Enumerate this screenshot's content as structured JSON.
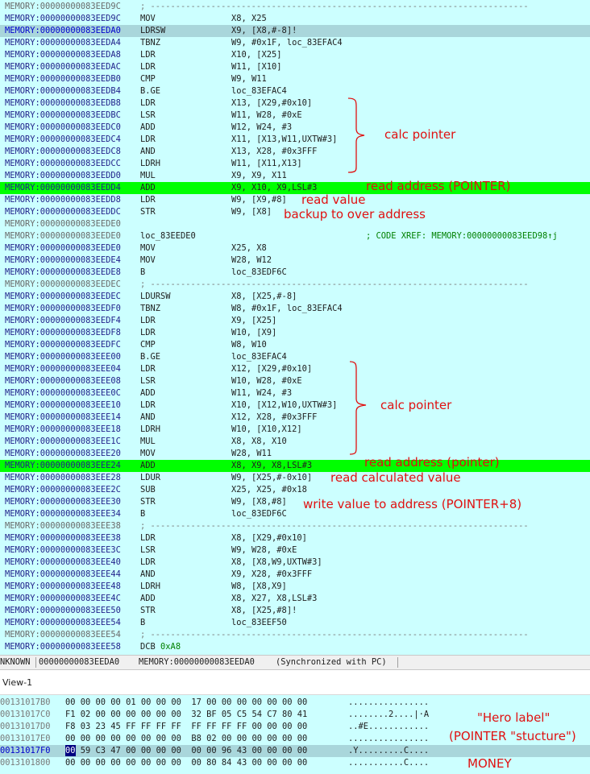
{
  "disasm": {
    "rows": [
      {
        "addr": "MEMORY:00000000083EED9C",
        "kind": "sep",
        "sep": "; ---------------------------------------------------------------------------"
      },
      {
        "addr": "MEMORY:00000000083EED9C",
        "mnem": "MOV",
        "ops": "X8, X25"
      },
      {
        "addr": "MEMORY:00000000083EEDA0",
        "mnem": "LDRSW",
        "ops": "X9, [X8,#-8]!",
        "hl": "blue"
      },
      {
        "addr": "MEMORY:00000000083EEDA4",
        "mnem": "TBNZ",
        "ops": "W9, #0x1F, loc_83EFAC4"
      },
      {
        "addr": "MEMORY:00000000083EEDA8",
        "mnem": "LDR",
        "ops": "X10, [X25]"
      },
      {
        "addr": "MEMORY:00000000083EEDAC",
        "mnem": "LDR",
        "ops": "W11, [X10]"
      },
      {
        "addr": "MEMORY:00000000083EEDB0",
        "mnem": "CMP",
        "ops": "W9, W11"
      },
      {
        "addr": "MEMORY:00000000083EEDB4",
        "mnem": "B.GE",
        "ops": "loc_83EFAC4"
      },
      {
        "addr": "MEMORY:00000000083EEDB8",
        "mnem": "LDR",
        "ops": "X13, [X29,#0x10]"
      },
      {
        "addr": "MEMORY:00000000083EEDBC",
        "mnem": "LSR",
        "ops": "W11, W28, #0xE"
      },
      {
        "addr": "MEMORY:00000000083EEDC0",
        "mnem": "ADD",
        "ops": "W12, W24, #3"
      },
      {
        "addr": "MEMORY:00000000083EEDC4",
        "mnem": "LDR",
        "ops": "X11, [X13,W11,UXTW#3]"
      },
      {
        "addr": "MEMORY:00000000083EEDC8",
        "mnem": "AND",
        "ops": "X13, X28, #0x3FFF"
      },
      {
        "addr": "MEMORY:00000000083EEDCC",
        "mnem": "LDRH",
        "ops": "W11, [X11,X13]"
      },
      {
        "addr": "MEMORY:00000000083EEDD0",
        "mnem": "MUL",
        "ops": "X9, X9, X11"
      },
      {
        "addr": "MEMORY:00000000083EEDD4",
        "mnem": "ADD",
        "ops": "X9, X10, X9,LSL#3",
        "hl": "green"
      },
      {
        "addr": "MEMORY:00000000083EEDD8",
        "mnem": "LDR",
        "ops": "W9, [X9,#8]"
      },
      {
        "addr": "MEMORY:00000000083EEDDC",
        "mnem": "STR",
        "ops": "W9, [X8]"
      },
      {
        "addr": "MEMORY:00000000083EEDE0",
        "kind": "empty"
      },
      {
        "addr": "MEMORY:00000000083EEDE0",
        "kind": "label",
        "label": "loc_83EEDE0",
        "xref": "; CODE XREF: MEMORY:00000000083EED98↑j"
      },
      {
        "addr": "MEMORY:00000000083EEDE0",
        "mnem": "MOV",
        "ops": "X25, X8"
      },
      {
        "addr": "MEMORY:00000000083EEDE4",
        "mnem": "MOV",
        "ops": "W28, W12"
      },
      {
        "addr": "MEMORY:00000000083EEDE8",
        "mnem": "B",
        "ops": "loc_83EDF6C"
      },
      {
        "addr": "MEMORY:00000000083EEDEC",
        "kind": "sep",
        "sep": "; ---------------------------------------------------------------------------"
      },
      {
        "addr": "MEMORY:00000000083EEDEC",
        "mnem": "LDURSW",
        "ops": "X8, [X25,#-8]"
      },
      {
        "addr": "MEMORY:00000000083EEDF0",
        "mnem": "TBNZ",
        "ops": "W8, #0x1F, loc_83EFAC4"
      },
      {
        "addr": "MEMORY:00000000083EEDF4",
        "mnem": "LDR",
        "ops": "X9, [X25]"
      },
      {
        "addr": "MEMORY:00000000083EEDF8",
        "mnem": "LDR",
        "ops": "W10, [X9]"
      },
      {
        "addr": "MEMORY:00000000083EEDFC",
        "mnem": "CMP",
        "ops": "W8, W10"
      },
      {
        "addr": "MEMORY:00000000083EEE00",
        "mnem": "B.GE",
        "ops": "loc_83EFAC4"
      },
      {
        "addr": "MEMORY:00000000083EEE04",
        "mnem": "LDR",
        "ops": "X12, [X29,#0x10]"
      },
      {
        "addr": "MEMORY:00000000083EEE08",
        "mnem": "LSR",
        "ops": "W10, W28, #0xE"
      },
      {
        "addr": "MEMORY:00000000083EEE0C",
        "mnem": "ADD",
        "ops": "W11, W24, #3"
      },
      {
        "addr": "MEMORY:00000000083EEE10",
        "mnem": "LDR",
        "ops": "X10, [X12,W10,UXTW#3]"
      },
      {
        "addr": "MEMORY:00000000083EEE14",
        "mnem": "AND",
        "ops": "X12, X28, #0x3FFF"
      },
      {
        "addr": "MEMORY:00000000083EEE18",
        "mnem": "LDRH",
        "ops": "W10, [X10,X12]"
      },
      {
        "addr": "MEMORY:00000000083EEE1C",
        "mnem": "MUL",
        "ops": "X8, X8, X10"
      },
      {
        "addr": "MEMORY:00000000083EEE20",
        "mnem": "MOV",
        "ops": "W28, W11"
      },
      {
        "addr": "MEMORY:00000000083EEE24",
        "mnem": "ADD",
        "ops": "X8, X9, X8,LSL#3",
        "hl": "green"
      },
      {
        "addr": "MEMORY:00000000083EEE28",
        "mnem": "LDUR",
        "ops": "W9, [X25,#-0x10]"
      },
      {
        "addr": "MEMORY:00000000083EEE2C",
        "mnem": "SUB",
        "ops": "X25, X25, #0x18"
      },
      {
        "addr": "MEMORY:00000000083EEE30",
        "mnem": "STR",
        "ops": "W9, [X8,#8]"
      },
      {
        "addr": "MEMORY:00000000083EEE34",
        "mnem": "B",
        "ops": "loc_83EDF6C"
      },
      {
        "addr": "MEMORY:00000000083EEE38",
        "kind": "sep",
        "sep": "; ---------------------------------------------------------------------------"
      },
      {
        "addr": "MEMORY:00000000083EEE38",
        "mnem": "LDR",
        "ops": "X8, [X29,#0x10]"
      },
      {
        "addr": "MEMORY:00000000083EEE3C",
        "mnem": "LSR",
        "ops": "W9, W28, #0xE"
      },
      {
        "addr": "MEMORY:00000000083EEE40",
        "mnem": "LDR",
        "ops": "X8, [X8,W9,UXTW#3]"
      },
      {
        "addr": "MEMORY:00000000083EEE44",
        "mnem": "AND",
        "ops": "X9, X28, #0x3FFF"
      },
      {
        "addr": "MEMORY:00000000083EEE48",
        "mnem": "LDRH",
        "ops": "W8, [X8,X9]"
      },
      {
        "addr": "MEMORY:00000000083EEE4C",
        "mnem": "ADD",
        "ops": "X8, X27, X8,LSL#3"
      },
      {
        "addr": "MEMORY:00000000083EEE50",
        "mnem": "STR",
        "ops": "X8, [X25,#8]!"
      },
      {
        "addr": "MEMORY:00000000083EEE54",
        "mnem": "B",
        "ops": "loc_83EEF50"
      },
      {
        "addr": "MEMORY:00000000083EEE54",
        "kind": "sep",
        "sep": "; ---------------------------------------------------------------------------"
      },
      {
        "addr": "MEMORY:00000000083EEE58",
        "kind": "dcb",
        "mnem": "DCB",
        "num": "0xA8"
      }
    ]
  },
  "annotations": {
    "calc_pointer_1": "calc pointer",
    "read_address_1": "read address (POINTER)",
    "read_value": "read value",
    "backup": "backup to over address",
    "calc_pointer_2": "calc pointer",
    "read_address_2": "read address (pointer)",
    "read_calculated": "read calculated value",
    "write_value": "write value to address (POINTER+8)",
    "hero_label": "\"Hero label\"",
    "pointer_structure": "(POINTER \"stucture\")",
    "money": "MONEY"
  },
  "statusbar": {
    "segment": "NKNOWN",
    "address": "00000000083EEDA0",
    "location": "MEMORY:00000000083EEDA0",
    "sync": "(Synchronized with PC)"
  },
  "hexview": {
    "tab_label": "View-1",
    "rows": [
      {
        "addr": "00131017B0",
        "bytes": "00 00 00 00 01 00 00 00  17 00 00 00 00 00 00 00",
        "ascii": "................"
      },
      {
        "addr": "00131017C0",
        "bytes": "F1 02 00 00 00 00 00 00  32 BF 05 C5 54 C7 80 41",
        "ascii": "........2....|·A"
      },
      {
        "addr": "00131017D0",
        "bytes": "F8 03 23 45 FF FF FF FF  FF FF FF FF 00 00 00 00",
        "ascii": "..#E............"
      },
      {
        "addr": "00131017E0",
        "bytes": "00 00 00 00 00 00 00 00  B8 02 00 00 00 00 00 00",
        "ascii": "................"
      },
      {
        "addr": "00131017F0",
        "bytes": "00 59 C3 47 00 00 00 00  00 00 96 43 00 00 00 00",
        "ascii": ".Y.........C....",
        "current": true,
        "selected": "00"
      },
      {
        "addr": "0013101800",
        "bytes": "00 00 00 00 00 00 00 00  00 80 84 43 00 00 00 00",
        "ascii": "...........C...."
      }
    ]
  },
  "colors": {
    "bg": "#ccffff",
    "highlight_blue": "#a9d6db",
    "highlight_green": "#00ff00",
    "annotation_red": "#e01010",
    "xref_green": "#008000"
  }
}
